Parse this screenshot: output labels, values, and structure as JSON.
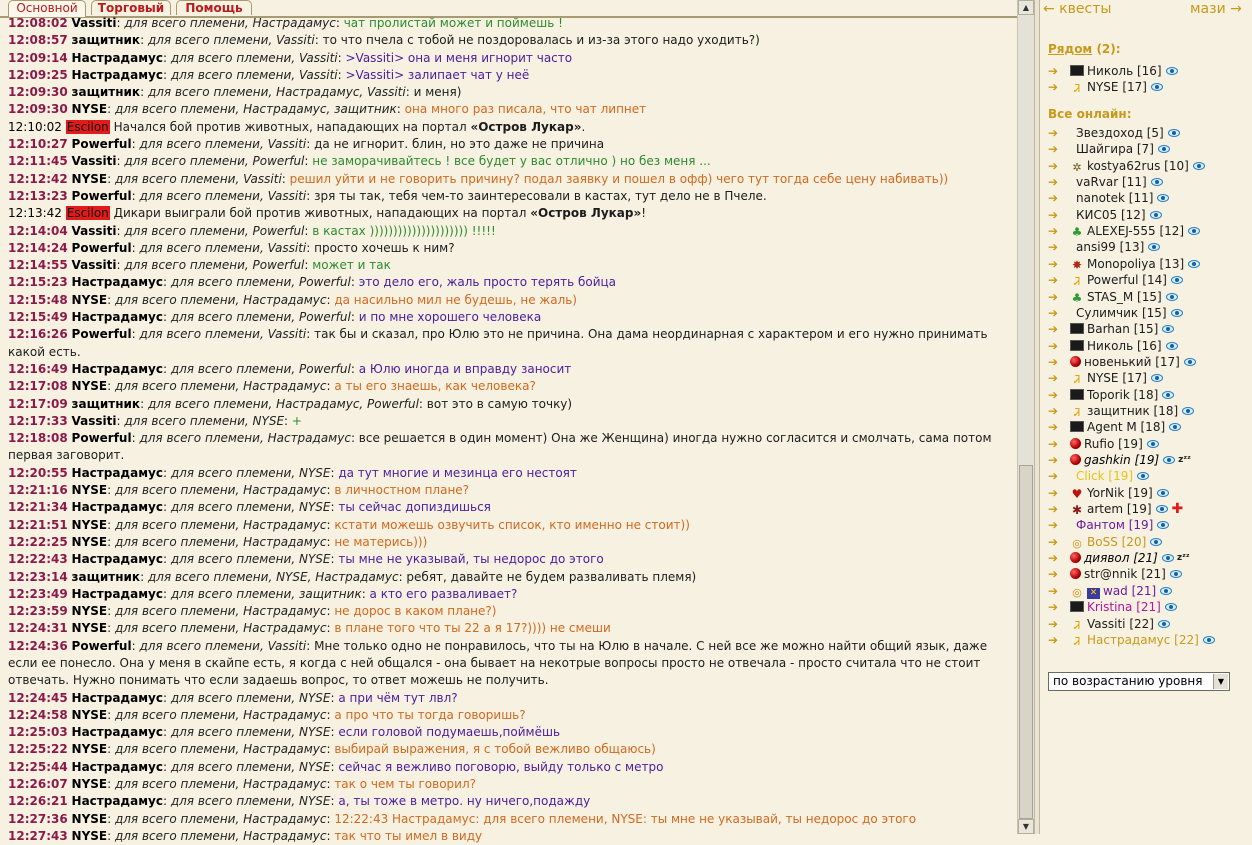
{
  "tabs": [
    "Основной",
    "Торговый",
    "Помощь"
  ],
  "recipients_all": "для всего племени",
  "messages": [
    {
      "time": "12:08:02",
      "from": "Vassiti",
      "to": "Настрадамус",
      "text": "чат пролистай может и поймешь !",
      "color": "green"
    },
    {
      "time": "12:08:57",
      "from": "защитник",
      "to": "Vassiti",
      "text": "то что пчела с тобой не поздоровалась и из-за этого надо уходить?)",
      "color": "black"
    },
    {
      "time": "12:09:14",
      "from": "Настрадамус",
      "to": "Vassiti",
      "text": ">Vassiti> она и меня игнорит часто",
      "color": "purple"
    },
    {
      "time": "12:09:25",
      "from": "Настрадамус",
      "to": "Vassiti",
      "text": ">Vassiti> залипает чат у неё",
      "color": "purple"
    },
    {
      "time": "12:09:30",
      "from": "защитник",
      "to": "Настрадамус, Vassiti",
      "text": "и меня)",
      "color": "black"
    },
    {
      "time": "12:09:30",
      "from": "NYSE",
      "to": "Настрадамус, защитник",
      "text": "она много раз писала, что чат липнет",
      "color": "orange"
    },
    {
      "system": true,
      "time": "12:10:02",
      "badge": "Escilon",
      "pre": "Начался бой против животных, нападающих на портал ",
      "bold": "«Остров Лукар»",
      "post": "."
    },
    {
      "time": "12:10:27",
      "from": "Powerful",
      "to": "Vassiti",
      "text": "да не игнорит. блин, но это даже не причина",
      "color": "black"
    },
    {
      "time": "12:11:45",
      "from": "Vassiti",
      "to": "Powerful",
      "text": "не заморачивайтесь ! все будет у вас отлично ) но без меня ...",
      "color": "green"
    },
    {
      "time": "12:12:42",
      "from": "NYSE",
      "to": "Vassiti",
      "text": "решил уйти и не говорить причину? подал заявку и пошел в офф) чего тут тогда себе цену набивать))",
      "color": "orange"
    },
    {
      "time": "12:13:23",
      "from": "Powerful",
      "to": "Vassiti",
      "text": "зря ты так, тебя чем-то заинтересовали в кастах, тут дело не в Пчеле.",
      "color": "black"
    },
    {
      "system": true,
      "time": "12:13:42",
      "badge": "Escilon",
      "pre": "Дикари выиграли бой против животных, нападающих на портал ",
      "bold": "«Остров Лукар»",
      "post": "!"
    },
    {
      "time": "12:14:04",
      "from": "Vassiti",
      "to": "Powerful",
      "text": "в кастах ))))))))))))))))))))) !!!!!",
      "color": "green"
    },
    {
      "time": "12:14:24",
      "from": "Powerful",
      "to": "Vassiti",
      "text": "просто хочешь к ним?",
      "color": "black"
    },
    {
      "time": "12:14:55",
      "from": "Vassiti",
      "to": "Powerful",
      "text": "может и так",
      "color": "green"
    },
    {
      "time": "12:15:23",
      "from": "Настрадамус",
      "to": "Powerful",
      "text": "это дело его, жаль просто терять бойца",
      "color": "purple"
    },
    {
      "time": "12:15:48",
      "from": "NYSE",
      "to": "Настрадамус",
      "text": "да насильно мил не будешь, не жаль)",
      "color": "orange"
    },
    {
      "time": "12:15:49",
      "from": "Настрадамус",
      "to": "Powerful",
      "text": "и по мне хорошего человека",
      "color": "purple"
    },
    {
      "time": "12:16:26",
      "from": "Powerful",
      "to": "Vassiti",
      "text": "так бы и сказал, про Юлю это не причина. Она дама неординарная с характером и его нужно принимать какой есть.",
      "color": "black"
    },
    {
      "time": "12:16:49",
      "from": "Настрадамус",
      "to": "Powerful",
      "text": "а Юлю иногда и вправду заносит",
      "color": "purple"
    },
    {
      "time": "12:17:08",
      "from": "NYSE",
      "to": "Настрадамус",
      "text": "а ты его знаешь, как человека?",
      "color": "orange"
    },
    {
      "time": "12:17:09",
      "from": "защитник",
      "to": "Настрадамус, Powerful",
      "text": "вот это в самую точку)",
      "color": "black"
    },
    {
      "time": "12:17:33",
      "from": "Vassiti",
      "to": "NYSE",
      "text": "+",
      "color": "green"
    },
    {
      "time": "12:18:08",
      "from": "Powerful",
      "to": "Настрадамус",
      "text": "все решается в один момент) Она же Женщина) иногда нужно согласится и смолчать, сама потом первая заговорит.",
      "color": "black"
    },
    {
      "time": "12:20:55",
      "from": "Настрадамус",
      "to": "NYSE",
      "text": "да тут многие и мезинца его нестоят",
      "color": "purple"
    },
    {
      "time": "12:21:16",
      "from": "NYSE",
      "to": "Настрадамус",
      "text": "в личностном плане?",
      "color": "orange"
    },
    {
      "time": "12:21:34",
      "from": "Настрадамус",
      "to": "NYSE",
      "text": "ты сейчас допиздишься",
      "color": "purple"
    },
    {
      "time": "12:21:51",
      "from": "NYSE",
      "to": "Настрадамус",
      "text": "кстати можешь озвучить список, кто именно не стоит))",
      "color": "orange"
    },
    {
      "time": "12:22:25",
      "from": "NYSE",
      "to": "Настрадамус",
      "text": "не матерись)))",
      "color": "orange"
    },
    {
      "time": "12:22:43",
      "from": "Настрадамус",
      "to": "NYSE",
      "text": "ты мне не указывай, ты недорос до этого",
      "color": "purple"
    },
    {
      "time": "12:23:14",
      "from": "защитник",
      "to": "NYSE, Настрадамус",
      "text": "ребят, давайте не будем разваливать племя)",
      "color": "black"
    },
    {
      "time": "12:23:49",
      "from": "Настрадамус",
      "to": "защитник",
      "text": "а кто его разваливает?",
      "color": "purple"
    },
    {
      "time": "12:23:59",
      "from": "NYSE",
      "to": "Настрадамус",
      "text": "не дорос в каком плане?)",
      "color": "orange"
    },
    {
      "time": "12:24:31",
      "from": "NYSE",
      "to": "Настрадамус",
      "text": "в плане того что ты 22 а я 17?)))) не смеши",
      "color": "orange"
    },
    {
      "time": "12:24:36",
      "from": "Powerful",
      "to": "Vassiti",
      "text": "Мне только одно не понравилось, что ты на Юлю в начале. С ней все же можно найти общий язык, даже если ее понесло. Она у меня в скайпе есть, я когда с ней общался - она бывает на некотрые вопросы просто не отвечала - просто считала что не стоит отвечать. Нужно понимать что если задаешь вопрос, то ответ можешь не получить.",
      "color": "black"
    },
    {
      "time": "12:24:45",
      "from": "Настрадамус",
      "to": "NYSE",
      "text": "а при чём тут лвл?",
      "color": "purple"
    },
    {
      "time": "12:24:58",
      "from": "NYSE",
      "to": "Настрадамус",
      "text": "а про что ты тогда говоришь?",
      "color": "orange"
    },
    {
      "time": "12:25:03",
      "from": "Настрадамус",
      "to": "NYSE",
      "text": "если головой подумаешь,поймёшь",
      "color": "purple"
    },
    {
      "time": "12:25:22",
      "from": "NYSE",
      "to": "Настрадамус",
      "text": "выбирай выражения, я с тобой вежливо общаюсь)",
      "color": "orange"
    },
    {
      "time": "12:25:44",
      "from": "Настрадамус",
      "to": "NYSE",
      "text": "сейчас я вежливо поговорю, выйду только с метро",
      "color": "purple"
    },
    {
      "time": "12:26:07",
      "from": "NYSE",
      "to": "Настрадамус",
      "text": "так о чем ты говорил?",
      "color": "orange"
    },
    {
      "time": "12:26:21",
      "from": "Настрадамус",
      "to": "NYSE",
      "text": "а, ты тоже в метро. ну ничего,подажду",
      "color": "purple"
    },
    {
      "time": "12:27:36",
      "from": "NYSE",
      "to": "Настрадамус",
      "text": "12:22:43 Настрадамус: для всего племени, NYSE: ты мне не указывай, ты недорос до этого",
      "color": "orange"
    },
    {
      "time": "12:27:43",
      "from": "NYSE",
      "to": "Настрадамус",
      "text": "так что ты имел в виду",
      "color": "orange"
    }
  ],
  "sidebar": {
    "nav_left": "← квесты",
    "nav_right": "мази →",
    "nearby_title": "Рядом",
    "nearby_count": "(2):",
    "online_title": "Все онлайн:",
    "nearby": [
      {
        "icon": "black-square-icon",
        "name": "Николь [16]",
        "style": "default"
      },
      {
        "icon": "gold-ribbon-icon",
        "name": "NYSE [17]",
        "style": "default"
      }
    ],
    "online": [
      {
        "icon": "none",
        "name": "Звездоход [5]",
        "style": "default"
      },
      {
        "icon": "none",
        "name": "Шайгира [7]",
        "style": "default"
      },
      {
        "icon": "gear-icon",
        "name": "kostya62rus [10]",
        "style": "default"
      },
      {
        "icon": "none",
        "name": "vaRvar [11]",
        "style": "default"
      },
      {
        "icon": "none",
        "name": "nanotek [11]",
        "style": "default"
      },
      {
        "icon": "none",
        "name": "КИС05 [12]",
        "style": "default"
      },
      {
        "icon": "clover-icon",
        "name": "ALEXEJ-555 [12]",
        "style": "default"
      },
      {
        "icon": "none",
        "name": "ansi99 [13]",
        "style": "default"
      },
      {
        "icon": "bug-icon",
        "name": "Monopoliya [13]",
        "style": "default"
      },
      {
        "icon": "gold-ribbon-icon",
        "name": "Powerful [14]",
        "style": "default"
      },
      {
        "icon": "clover-icon",
        "name": "STAS_M [15]",
        "style": "default"
      },
      {
        "icon": "none",
        "name": "Сулимчик [15]",
        "style": "default"
      },
      {
        "icon": "black-square-icon",
        "name": "Barhan [15]",
        "style": "default"
      },
      {
        "icon": "black-square-icon",
        "name": "Николь [16]",
        "style": "default"
      },
      {
        "icon": "red-ball-icon",
        "name": "новенький [17]",
        "style": "default"
      },
      {
        "icon": "gold-ribbon-icon",
        "name": "NYSE [17]",
        "style": "default"
      },
      {
        "icon": "black-square-icon",
        "name": "Toporik [18]",
        "style": "default"
      },
      {
        "icon": "gold-ribbon-icon",
        "name": "защитник [18]",
        "style": "default"
      },
      {
        "icon": "black-square-icon",
        "name": "Agent M [18]",
        "style": "default"
      },
      {
        "icon": "red-ball-icon",
        "name": "Rufio [19]",
        "style": "default"
      },
      {
        "icon": "red-ball-icon",
        "name": "gashkin [19]",
        "style": "italic",
        "sleep": true
      },
      {
        "icon": "none",
        "name": "Click [19]",
        "style": "yellow"
      },
      {
        "icon": "heart-icon",
        "name": "YorNik [19]",
        "style": "default"
      },
      {
        "icon": "bug2-icon",
        "name": "artem [19]",
        "style": "default",
        "cross": true
      },
      {
        "icon": "none",
        "name": "Фантом [19]",
        "style": "purple"
      },
      {
        "icon": "coin-icon",
        "name": "BoSS [20]",
        "style": "gold"
      },
      {
        "icon": "red-ball-icon",
        "name": "диявол [21]",
        "style": "italic",
        "sleep": true
      },
      {
        "icon": "red-ball-icon",
        "name": "str@nnik [21]",
        "style": "default"
      },
      {
        "icon": "coin-icon",
        "name": "wad [21]",
        "style": "purple",
        "extra": "✕"
      },
      {
        "icon": "black-square-icon",
        "name": "Kristina [21]",
        "style": "magenta"
      },
      {
        "icon": "gold-ribbon-icon",
        "name": "Vassiti [22]",
        "style": "default"
      },
      {
        "icon": "gold-ribbon-icon",
        "name": "Настрадамус [22]",
        "style": "gold"
      }
    ],
    "sort_value": "по возрастанию уровня"
  },
  "colors": {
    "background": "#F7F1E1",
    "time": "#8B1A4A",
    "green": "#2E8B2E",
    "orange": "#D2691E",
    "purple": "#4B1C9E",
    "gold": "#C89A1B",
    "badge": "#E21A1A"
  }
}
